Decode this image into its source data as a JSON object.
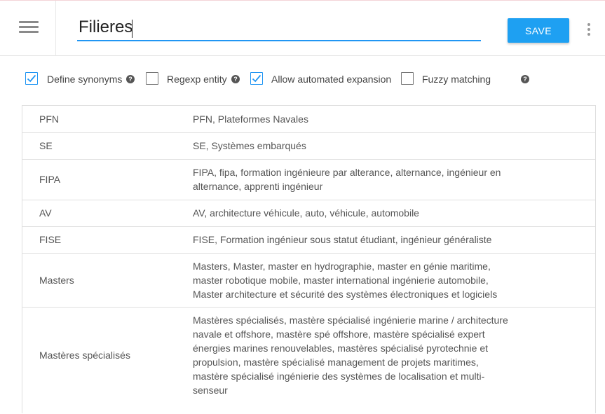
{
  "header": {
    "entity_name": "Filieres",
    "save_label": "SAVE"
  },
  "options": [
    {
      "label": "Define synonyms",
      "checked": true,
      "help": true
    },
    {
      "label": "Regexp entity",
      "checked": false,
      "help": true
    },
    {
      "label": "Allow automated expansion",
      "checked": true,
      "help": false
    },
    {
      "label": "Fuzzy matching",
      "checked": false,
      "help": true
    }
  ],
  "colors": {
    "accent": "#2196f3",
    "save_button": "#1ea0f2"
  },
  "entries": [
    {
      "key": "PFN",
      "value": "PFN, Plateformes Navales"
    },
    {
      "key": "SE",
      "value": "SE, Systèmes embarqués"
    },
    {
      "key": "FIPA",
      "value": "FIPA, fipa, formation ingénieure par alterance, alternance, ingénieur en alternance, apprenti ingénieur"
    },
    {
      "key": "AV",
      "value": "AV, architecture véhicule, auto, véhicule, automobile"
    },
    {
      "key": "FISE",
      "value": "FISE, Formation ingénieur sous statut étudiant, ingénieur généraliste"
    },
    {
      "key": "Masters",
      "value": "Masters, Master, master en hydrographie, master en génie maritime, master robotique mobile, master international ingénierie automobile, Master architecture et sécurité des systèmes électroniques et logiciels"
    },
    {
      "key": "Mastères spécialisés",
      "value": "Mastères spécialisés, mastère spécialisé ingénierie marine / architecture navale et offshore, mastère spé offshore, mastère spécialisé expert énergies marines renouvelables, mastères spécialisé pyrotechnie et propulsion, mastère spécialisé management de projets maritimes, mastère spécialisé ingénierie des systèmes de localisation et multi-senseur"
    }
  ]
}
